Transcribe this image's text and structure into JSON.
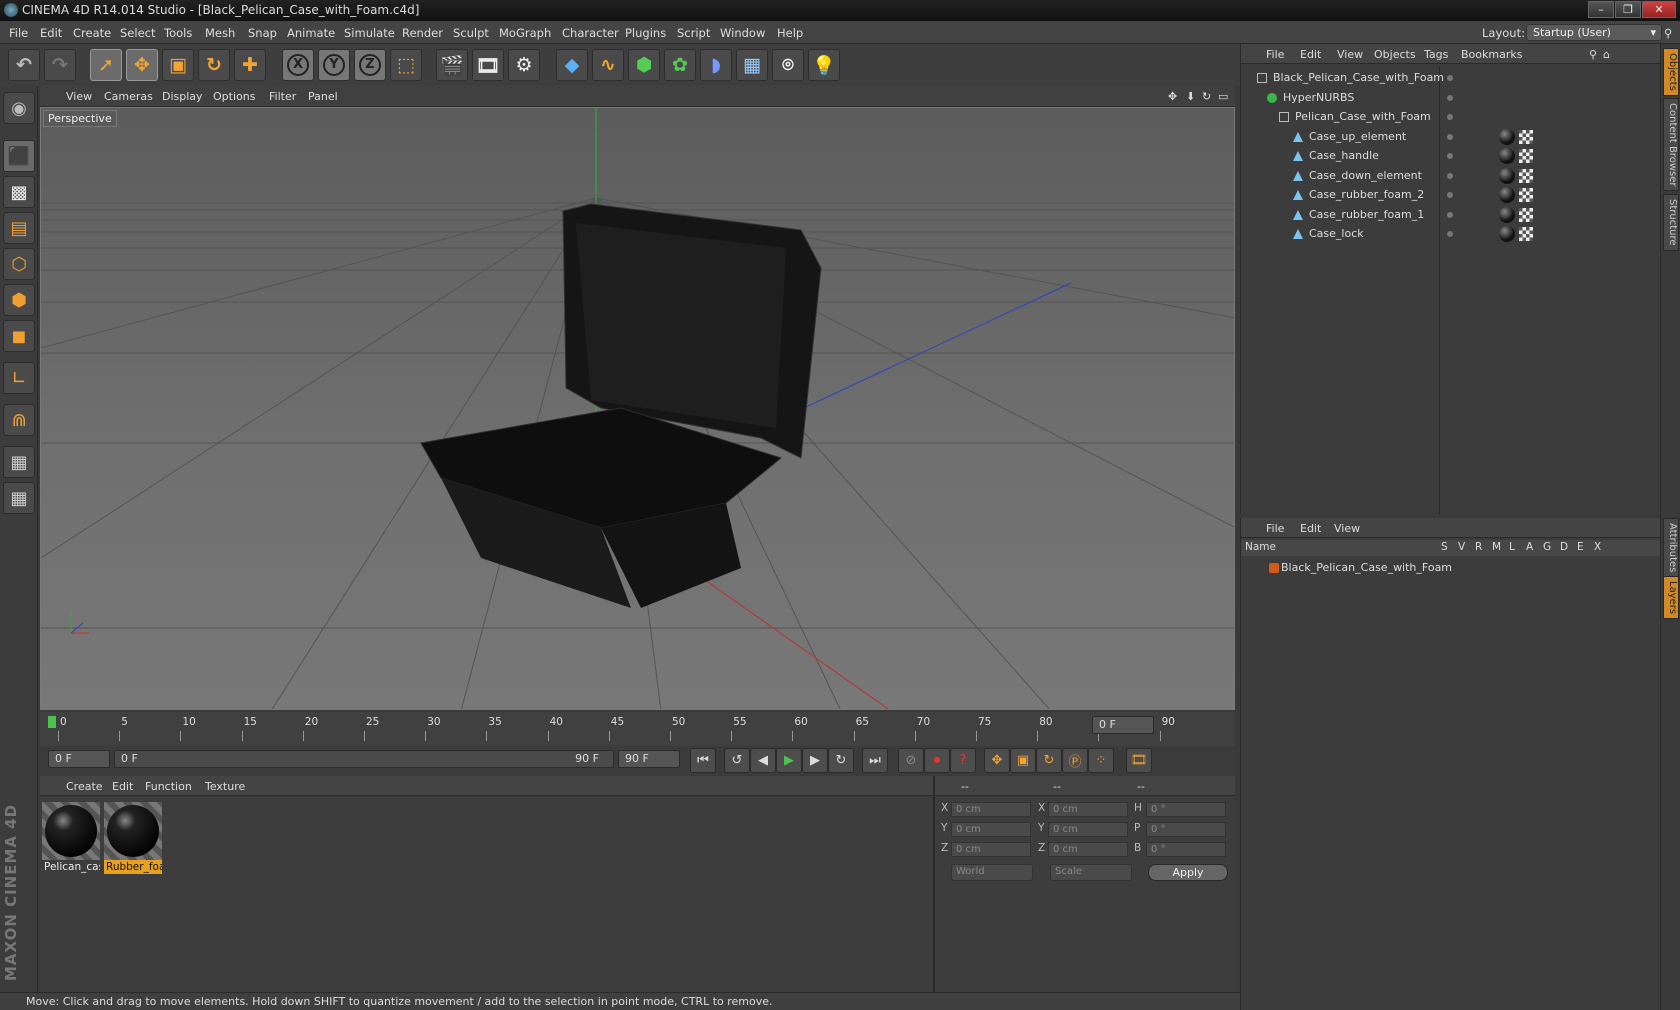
{
  "app": {
    "title": "CINEMA 4D R14.014 Studio - [Black_Pelican_Case_with_Foam.c4d]"
  },
  "window": {
    "min": "–",
    "max": "❐",
    "close": "✕"
  },
  "menu": [
    "File",
    "Edit",
    "Create",
    "Select",
    "Tools",
    "Mesh",
    "Snap",
    "Animate",
    "Simulate",
    "Render",
    "Sculpt",
    "MoGraph",
    "Character",
    "Plugins",
    "Script",
    "Window",
    "Help"
  ],
  "layout": {
    "label": "Layout:",
    "value": "Startup (User)"
  },
  "toolbar": {
    "icons": [
      "undo-icon",
      "redo-icon",
      "live-selection-icon",
      "move-icon",
      "scale-icon",
      "rotate-icon",
      "add-object-icon",
      "x-axis-lock",
      "y-axis-lock",
      "z-axis-lock",
      "coordinate-system-icon",
      "render-view-icon",
      "render-picture-viewer-icon",
      "render-settings-icon",
      "cube-primitive-icon",
      "spline-icon",
      "nurbs-icon",
      "array-icon",
      "deformer-icon",
      "scene-floor-icon",
      "camera-icon",
      "light-icon"
    ],
    "xyz": [
      "X",
      "Y",
      "Z"
    ]
  },
  "viewport": {
    "menu": [
      "View",
      "Cameras",
      "Display",
      "Options",
      "Filter",
      "Panel"
    ],
    "label": "Perspective"
  },
  "timeline": {
    "ticks": [
      "0",
      "5",
      "10",
      "15",
      "20",
      "25",
      "30",
      "35",
      "40",
      "45",
      "50",
      "55",
      "60",
      "65",
      "70",
      "75",
      "80",
      "85",
      "90"
    ],
    "current_frame": "0 F",
    "start": "0 F",
    "range_start": "0 F",
    "range_end": "90 F",
    "end": "90 F"
  },
  "materials": {
    "menu": [
      "Create",
      "Edit",
      "Function",
      "Texture"
    ],
    "items": [
      {
        "name": "Pelican_cas",
        "selected": false
      },
      {
        "name": "Rubber_foa",
        "selected": true
      }
    ]
  },
  "coords": {
    "headers": [
      "--",
      "--",
      "--"
    ],
    "rows": [
      {
        "a": "X",
        "av": "0 cm",
        "b": "X",
        "bv": "0 cm",
        "c": "H",
        "cv": "0 °"
      },
      {
        "a": "Y",
        "av": "0 cm",
        "b": "Y",
        "bv": "0 cm",
        "c": "P",
        "cv": "0 °"
      },
      {
        "a": "Z",
        "av": "0 cm",
        "b": "Z",
        "bv": "0 cm",
        "c": "B",
        "cv": "0 °"
      }
    ],
    "world": "World",
    "scale": "Scale",
    "apply": "Apply"
  },
  "status": "Move: Click and drag to move elements. Hold down SHIFT to quantize movement / add to the selection in point mode, CTRL to remove.",
  "objects": {
    "menu": [
      "File",
      "Edit",
      "View",
      "Objects",
      "Tags",
      "Bookmarks"
    ],
    "tree": [
      {
        "name": "Black_Pelican_Case_with_Foam",
        "depth": 0
      },
      {
        "name": "HyperNURBS",
        "depth": 1
      },
      {
        "name": "Pelican_Case_with_Foam",
        "depth": 2
      },
      {
        "name": "Case_up_element",
        "depth": 3
      },
      {
        "name": "Case_handle",
        "depth": 3
      },
      {
        "name": "Case_down_element",
        "depth": 3
      },
      {
        "name": "Case_rubber_foam_2",
        "depth": 3
      },
      {
        "name": "Case_rubber_foam_1",
        "depth": 3
      },
      {
        "name": "Case_lock",
        "depth": 3
      }
    ]
  },
  "layers": {
    "menu": [
      "File",
      "Edit",
      "View"
    ],
    "name_header": "Name",
    "cols": [
      "S",
      "V",
      "R",
      "M",
      "L",
      "A",
      "G",
      "D",
      "E",
      "X"
    ],
    "rows": [
      {
        "name": "Black_Pelican_Case_with_Foam"
      }
    ]
  },
  "sidetabs": [
    "Objects",
    "Content Browser",
    "Structure",
    "Attributes",
    "Layers"
  ],
  "brand": "MAXON CINEMA 4D",
  "colors": {
    "accent": "#f2a533",
    "selected_material": "#e8a11e",
    "x_axis": "#c03030",
    "y_axis": "#30b030",
    "z_axis": "#3040c0"
  }
}
